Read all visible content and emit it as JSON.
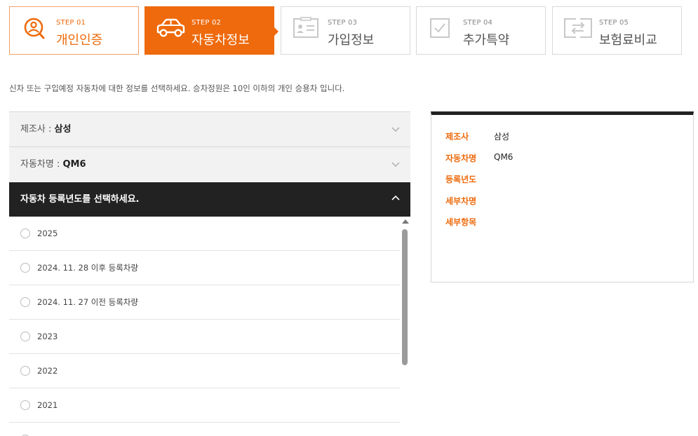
{
  "steps": [
    {
      "num": "STEP 01",
      "title": "개인인증",
      "icon": "search-person-icon",
      "state": "done"
    },
    {
      "num": "STEP 02",
      "title": "자동차정보",
      "icon": "car-icon",
      "state": "active"
    },
    {
      "num": "STEP 03",
      "title": "가입정보",
      "icon": "id-card-icon",
      "state": "todo"
    },
    {
      "num": "STEP 04",
      "title": "추가특약",
      "icon": "checkbox-icon",
      "state": "todo"
    },
    {
      "num": "STEP 05",
      "title": "보험료비교",
      "icon": "compare-icon",
      "state": "todo"
    }
  ],
  "description": "신차 또는 구입예정 자동차에 대한 정보를 선택하세요. 승차정원은 10인 이하의 개인 승용차 입니다.",
  "accordion": {
    "maker": {
      "label": "제조사 : ",
      "value": "삼성"
    },
    "model": {
      "label": "자동차명 : ",
      "value": "QM6"
    },
    "year_header": "자동차 등록년도를 선택하세요.",
    "year_options": [
      "2025",
      "2024. 11. 28 이후 등록차량",
      "2024. 11. 27 이전 등록차량",
      "2023",
      "2022",
      "2021",
      ""
    ]
  },
  "summary": {
    "rows": [
      {
        "key": "제조사",
        "value": "삼성"
      },
      {
        "key": "자동차명",
        "value": "QM6"
      },
      {
        "key": "등록년도",
        "value": ""
      },
      {
        "key": "세부차명",
        "value": ""
      },
      {
        "key": "세부항목",
        "value": ""
      }
    ]
  },
  "colors": {
    "accent": "#ee6a0c",
    "dark": "#222222",
    "panel": "#f2f2f2"
  }
}
